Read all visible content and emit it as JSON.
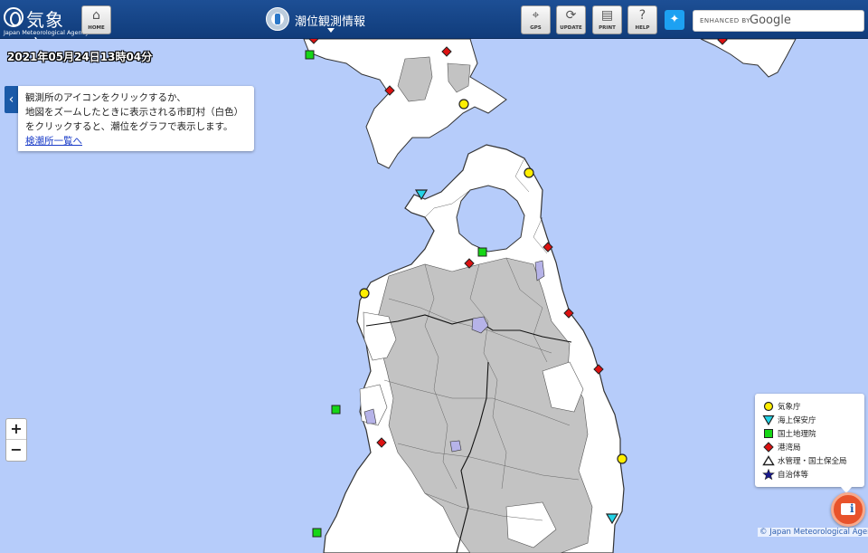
{
  "header": {
    "logo_name": "気象庁",
    "logo_sub": "Japan Meteorological Agency",
    "home_label": "HOME",
    "title": "潮位観測情報",
    "gps_label": "GPS",
    "update_label": "UPDATE",
    "print_label": "PRINT",
    "help_label": "HELP",
    "search_enhanced": "ENHANCED BY",
    "search_brand": "Google"
  },
  "datetime": "2021年05月24日13時04分",
  "info_panel": {
    "line1": "観測所のアイコンをクリックするか、",
    "line2": "地図をズームしたときに表示される市町村（白色）",
    "line3": "をクリックすると、潮位をグラフで表示します。",
    "link": "検潮所一覧へ"
  },
  "zoom": {
    "in": "+",
    "out": "−"
  },
  "legend": [
    {
      "label": "気象庁",
      "symbol": "circle-yellow",
      "color": "#ffee00"
    },
    {
      "label": "海上保安庁",
      "symbol": "triangle-down-cyan",
      "color": "#22d3e6"
    },
    {
      "label": "国土地理院",
      "symbol": "square-green",
      "color": "#16d616"
    },
    {
      "label": "港湾局",
      "symbol": "diamond-red",
      "color": "#dd1111"
    },
    {
      "label": "水管理・国土保全局",
      "symbol": "triangle-up-white",
      "color": "#ffffff"
    },
    {
      "label": "自治体等",
      "symbol": "star-navy",
      "color": "#1a1a8c"
    }
  ],
  "attribution": "© Japan Meteorological Agency",
  "colors": {
    "sea": "#b6ccfa",
    "land": "#ffffff",
    "shaded_municipality": "#c3c3c3",
    "header": "#164589"
  }
}
